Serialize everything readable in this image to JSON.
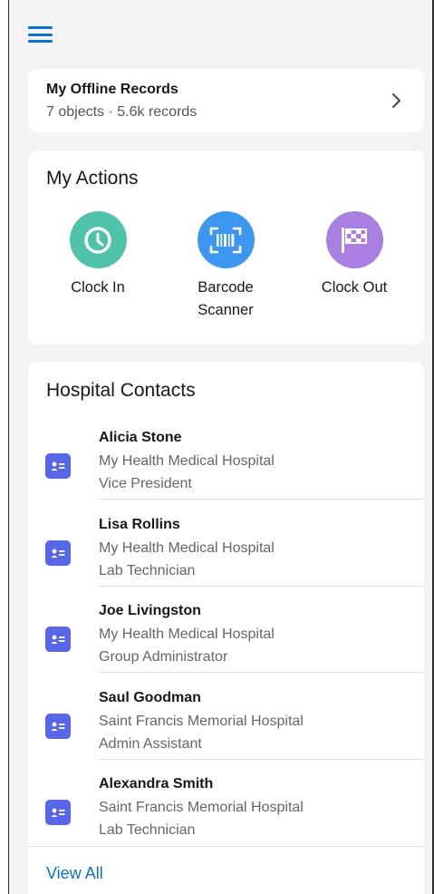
{
  "nav": {
    "menu_icon": "hamburger-menu-icon"
  },
  "offline_records": {
    "title": "My Offline Records",
    "summary": "7 objects · 5.6k records",
    "chevron_icon": "chevron-right-icon"
  },
  "actions": {
    "title": "My Actions",
    "items": [
      {
        "label": "Clock In",
        "icon": "clock-icon",
        "color": "#4fc3a9"
      },
      {
        "label": "Barcode\nScanner",
        "icon": "barcode-scanner-icon",
        "color": "#3d97f0"
      },
      {
        "label": "Clock Out",
        "icon": "checkered-flag-icon",
        "color": "#a97fe2"
      }
    ]
  },
  "contacts": {
    "title": "Hospital Contacts",
    "avatar_icon": "contact-card-icon",
    "avatar_color": "#5867e8",
    "items": [
      {
        "name": "Alicia Stone",
        "org": "My Health Medical Hospital",
        "role": "Vice President"
      },
      {
        "name": "Lisa Rollins",
        "org": "My Health Medical Hospital",
        "role": "Lab Technician"
      },
      {
        "name": "Joe Livingston",
        "org": "My Health Medical Hospital",
        "role": "Group Administrator"
      },
      {
        "name": "Saul Goodman",
        "org": "Saint Francis Memorial Hospital",
        "role": "Admin Assistant"
      },
      {
        "name": "Alexandra Smith",
        "org": "Saint Francis Memorial Hospital",
        "role": "Lab Technician"
      }
    ],
    "view_all": "View All"
  },
  "colors": {
    "accent": "#0b6fd6",
    "background": "#f3f3f3",
    "card": "#ffffff"
  }
}
